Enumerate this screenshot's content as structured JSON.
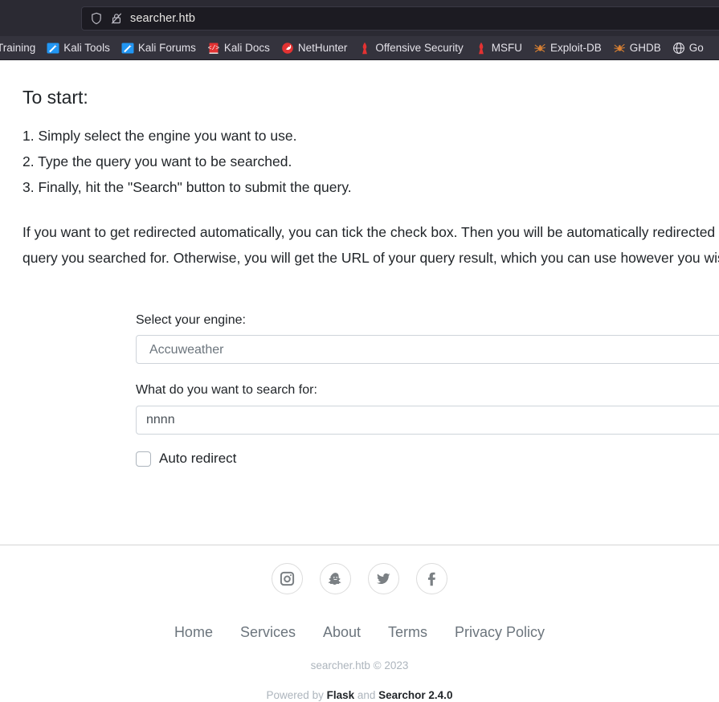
{
  "browser": {
    "urlbar": {
      "value": "searcher.htb",
      "shield_icon": "shield-icon",
      "security_icon": "insecure-padlock-icon"
    },
    "bookmarks": [
      {
        "label": "Training",
        "icon": "kali-training-icon"
      },
      {
        "label": "Kali Tools",
        "icon": "kali-tools-icon"
      },
      {
        "label": "Kali Forums",
        "icon": "kali-forums-icon"
      },
      {
        "label": "Kali Docs",
        "icon": "kali-docs-book-icon"
      },
      {
        "label": "NetHunter",
        "icon": "nethunter-dragon-icon"
      },
      {
        "label": "Offensive Security",
        "icon": "offensive-security-icon"
      },
      {
        "label": "MSFU",
        "icon": "msfu-icon"
      },
      {
        "label": "Exploit-DB",
        "icon": "exploit-db-spider-icon"
      },
      {
        "label": "GHDB",
        "icon": "ghdb-spider-icon"
      },
      {
        "label": "Go",
        "icon": "globe-icon"
      }
    ]
  },
  "page": {
    "instructions": {
      "title": "To start:",
      "steps": [
        "1. Simply select the engine you want to use.",
        "2. Type the query you want to be searched.",
        "3. Finally, hit the \"Search\" button to submit the query."
      ],
      "paragraph": "If you want to get redirected automatically, you can tick the check box. Then you will be automatically redirected to the selected engine with the results of the query you searched for. Otherwise, you will get the URL of your query result, which you can use however you wish."
    },
    "form": {
      "engine_label": "Select your engine:",
      "engine_value": "Accuweather",
      "query_label": "What do you want to search for:",
      "query_value": "nnnn",
      "query_placeholder": "",
      "auto_redirect_label": "Auto redirect",
      "auto_redirect_checked": false
    },
    "footer": {
      "social": [
        {
          "name": "instagram-icon",
          "title": "Instagram"
        },
        {
          "name": "snapchat-icon",
          "title": "Snapchat"
        },
        {
          "name": "twitter-icon",
          "title": "Twitter"
        },
        {
          "name": "facebook-icon",
          "title": "Facebook"
        }
      ],
      "links": [
        "Home",
        "Services",
        "About",
        "Terms",
        "Privacy Policy"
      ],
      "copyright": "searcher.htb © 2023",
      "powered_prefix": "Powered by ",
      "powered_flask": "Flask",
      "powered_and": " and ",
      "powered_searchor": "Searchor 2.4.0"
    }
  },
  "colors": {
    "chrome_bg": "#2b2a33",
    "bookmarks_bg": "#34333d",
    "urlbar_bg": "#1c1b22",
    "kali_blue": "#2196f3",
    "kali_red": "#e23232",
    "exploit_orange": "#d98032",
    "muted": "#6c757d",
    "footer_icon": "#7b8084"
  }
}
